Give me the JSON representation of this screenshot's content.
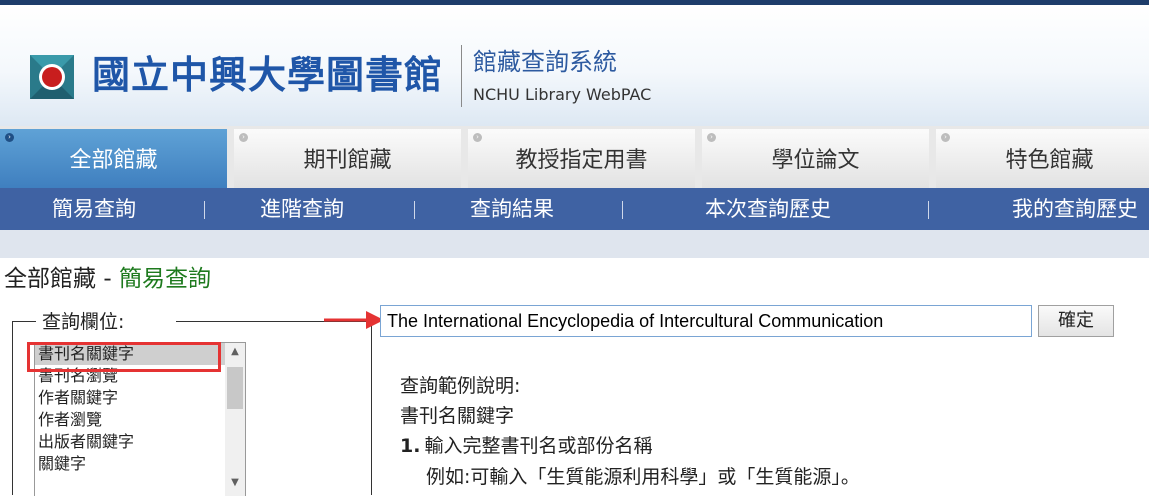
{
  "header": {
    "library_name": "國立中興大學圖書館",
    "system_title": "館藏查詢系統",
    "system_subtitle": "NCHU Library WebPAC"
  },
  "tabs": [
    {
      "label": "全部館藏",
      "active": true
    },
    {
      "label": "期刊館藏",
      "active": false
    },
    {
      "label": "教授指定用書",
      "active": false
    },
    {
      "label": "學位論文",
      "active": false
    },
    {
      "label": "特色館藏",
      "active": false
    }
  ],
  "subnav": [
    "簡易查詢",
    "進階查詢",
    "查詢結果",
    "本次查詢歷史",
    "我的查詢歷史"
  ],
  "page_title": {
    "main": "全部館藏",
    "separator": "-",
    "sub": "簡易查詢"
  },
  "field_select": {
    "legend": "查詢欄位:",
    "options": [
      "書刊名關鍵字",
      "書刊名瀏覽",
      "作者關鍵字",
      "作者瀏覽",
      "出版者關鍵字",
      "關鍵字"
    ],
    "selected": "書刊名關鍵字"
  },
  "search": {
    "value": "The International Encyclopedia of Intercultural Communication",
    "submit_label": "確定"
  },
  "help": {
    "title": "查詢範例說明:",
    "field": "書刊名關鍵字",
    "step1_num": "1.",
    "step1_text": "輸入完整書刊名或部份名稱",
    "example": "例如:可輸入「生質能源利用科學」或「生質能源」。"
  },
  "colors": {
    "brand_blue": "#1f56a8",
    "active_tab": "#4b8cc8",
    "subnav": "#3f62a3",
    "highlight": "#e53333",
    "title_green": "#1e7a1e"
  }
}
